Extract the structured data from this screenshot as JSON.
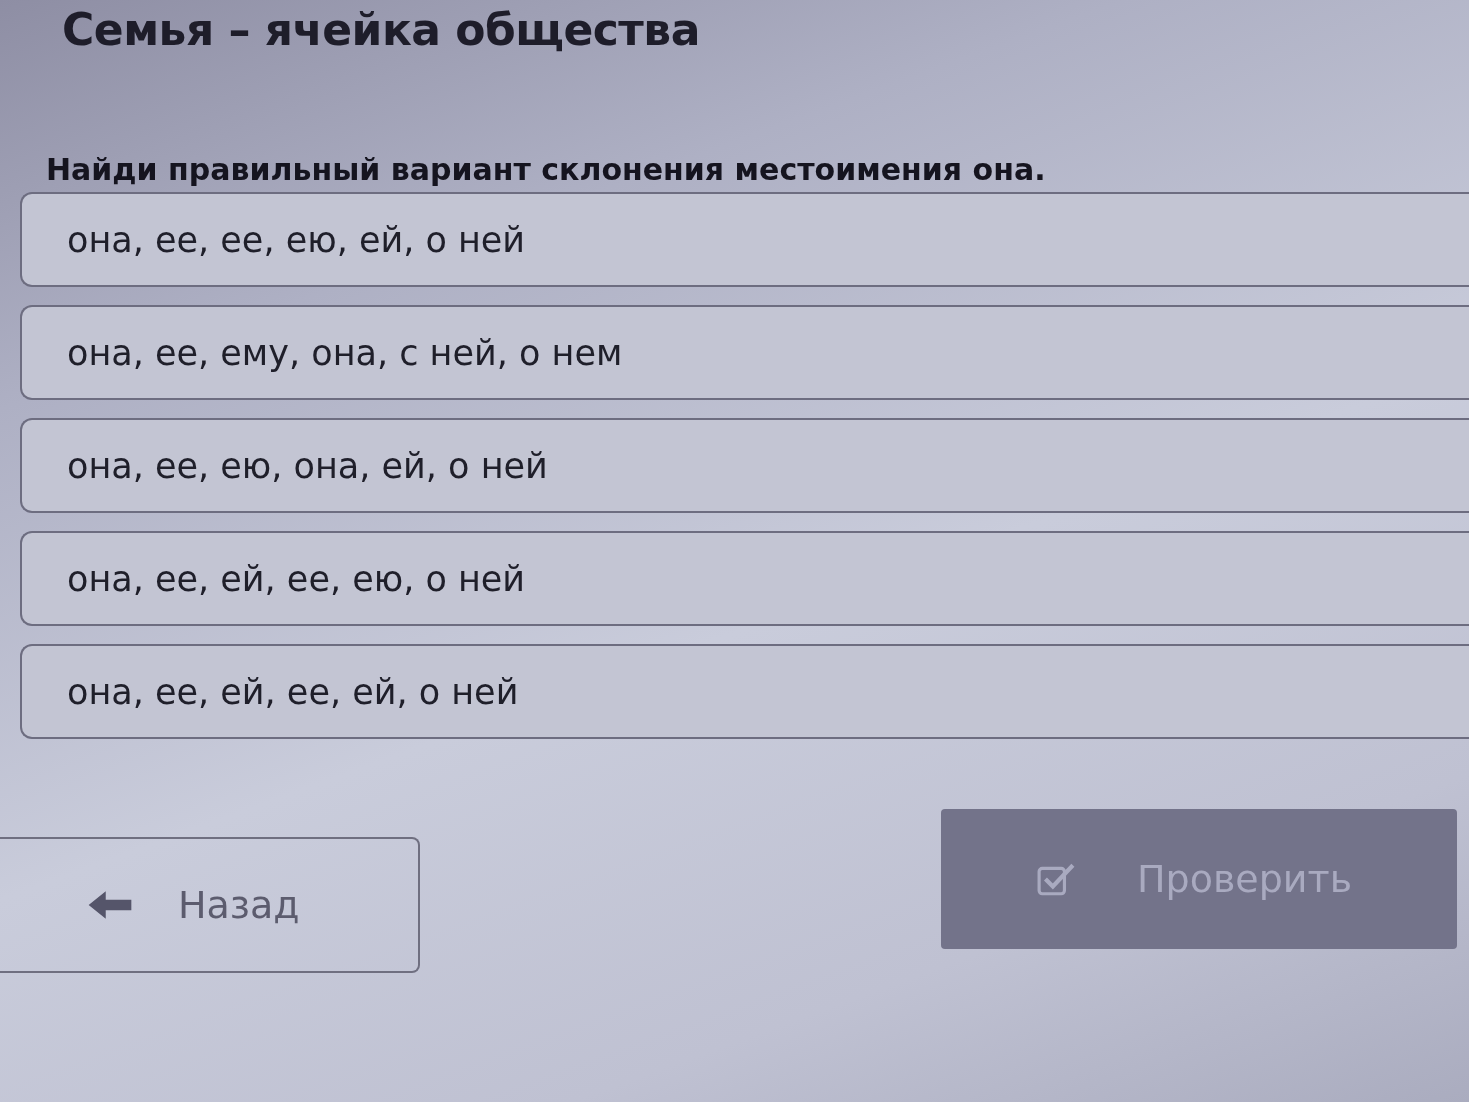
{
  "title": "Семья – ячейка общества",
  "question": "Найди правильный вариант склонения местоимения она.",
  "options": [
    {
      "label": "она, ее, ее, ею, ей, о ней",
      "selected": false
    },
    {
      "label": "она, ее, ему, она, с ней, о нем",
      "selected": false
    },
    {
      "label": "она, ее, ею, она, ей, о ней",
      "selected": false
    },
    {
      "label": "она, ее, ей, ее, ею, о ней",
      "selected": false
    },
    {
      "label": "она, ее, ей, ее, ей, о ней",
      "selected": false
    }
  ],
  "buttons": [
    {
      "kind": "back",
      "label": "Назад",
      "disabled": false
    },
    {
      "kind": "check",
      "label": "Проверить",
      "disabled": true
    }
  ]
}
